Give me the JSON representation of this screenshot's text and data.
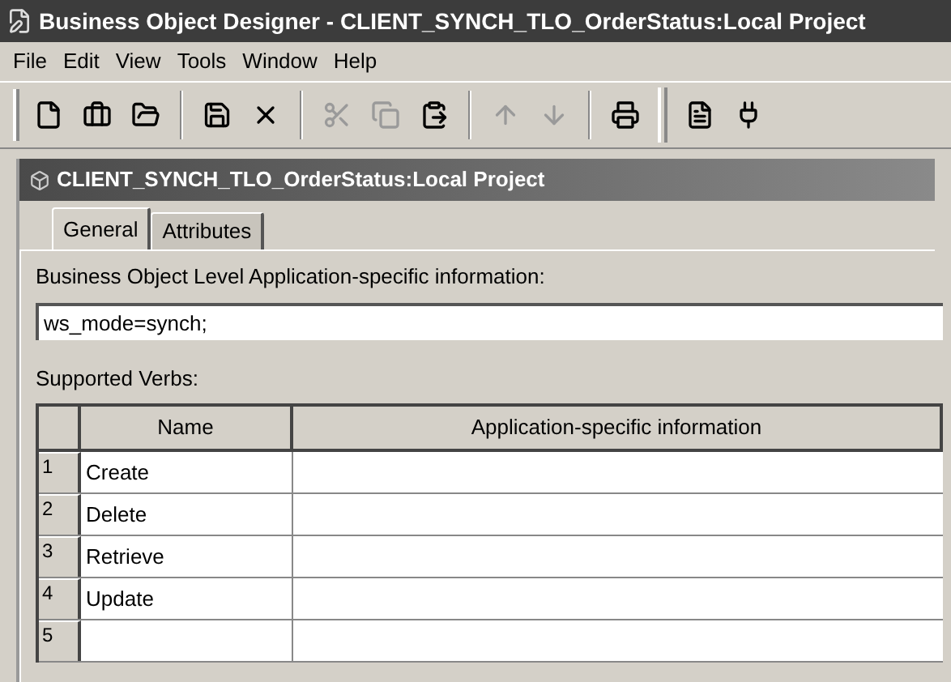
{
  "window": {
    "title": "Business Object Designer - CLIENT_SYNCH_TLO_OrderStatus:Local Project"
  },
  "menu": [
    "File",
    "Edit",
    "View",
    "Tools",
    "Window",
    "Help"
  ],
  "toolbar": [
    {
      "kind": "new",
      "disabled": false
    },
    {
      "kind": "object",
      "disabled": false
    },
    {
      "kind": "open",
      "disabled": false
    },
    {
      "kind": "sep"
    },
    {
      "kind": "save",
      "disabled": false
    },
    {
      "kind": "delete",
      "disabled": false
    },
    {
      "kind": "sep"
    },
    {
      "kind": "cut",
      "disabled": true
    },
    {
      "kind": "copy",
      "disabled": true
    },
    {
      "kind": "paste",
      "disabled": false
    },
    {
      "kind": "sep"
    },
    {
      "kind": "up",
      "disabled": true
    },
    {
      "kind": "down",
      "disabled": true
    },
    {
      "kind": "sep"
    },
    {
      "kind": "print",
      "disabled": false
    },
    {
      "kind": "grip"
    },
    {
      "kind": "list",
      "disabled": false
    },
    {
      "kind": "plug",
      "disabled": false
    }
  ],
  "document": {
    "title": "CLIENT_SYNCH_TLO_OrderStatus:Local Project",
    "tabs": [
      {
        "label": "General",
        "selected": true
      },
      {
        "label": "Attributes",
        "selected": false
      }
    ],
    "asi_label": "Business Object Level Application-specific information:",
    "asi_value": "ws_mode=synch;",
    "verbs_label": "Supported Verbs:",
    "table": {
      "columns": [
        "Name",
        "Application-specific information"
      ],
      "rows": [
        {
          "number": "1",
          "name": "Create"
        },
        {
          "number": "2",
          "name": "Delete"
        },
        {
          "number": "3",
          "name": "Retrieve"
        },
        {
          "number": "4",
          "name": "Update"
        },
        {
          "number": "5"
        }
      ]
    }
  }
}
